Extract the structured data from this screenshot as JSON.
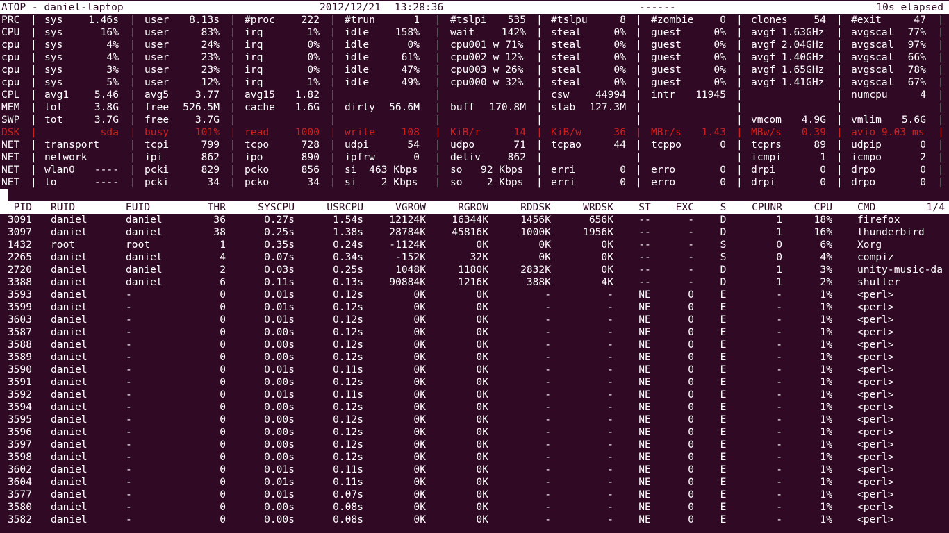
{
  "header": {
    "title": "ATOP - daniel-laptop",
    "date": "2012/12/21",
    "time": "13:28:36",
    "flags": "------",
    "elapsed": "10s elapsed"
  },
  "system_rows": [
    {
      "type": "PRC",
      "cells": [
        [
          "sys",
          "1.46s"
        ],
        [
          "user",
          "8.13s"
        ],
        [
          "#proc",
          "222"
        ],
        [
          "#trun",
          "1"
        ],
        [
          "#tslpi",
          "535"
        ],
        [
          "#tslpu",
          "8"
        ],
        [
          "#zombie",
          "0"
        ],
        [
          "clones",
          "54"
        ],
        [
          "#exit",
          "47"
        ]
      ]
    },
    {
      "type": "CPU",
      "cells": [
        [
          "sys",
          "16%"
        ],
        [
          "user",
          "83%"
        ],
        [
          "irq",
          "1%"
        ],
        [
          "idle",
          "158%"
        ],
        [
          "wait",
          "142%"
        ],
        [
          "steal",
          "0%"
        ],
        [
          "guest",
          "0%"
        ],
        [
          "avgf 1.63GHz",
          ""
        ],
        [
          "avgscal",
          "77%"
        ]
      ]
    },
    {
      "type": "cpu",
      "cells": [
        [
          "sys",
          "4%"
        ],
        [
          "user",
          "24%"
        ],
        [
          "irq",
          "0%"
        ],
        [
          "idle",
          "0%"
        ],
        [
          "cpu001 w 71%",
          ""
        ],
        [
          "steal",
          "0%"
        ],
        [
          "guest",
          "0%"
        ],
        [
          "avgf 2.04GHz",
          ""
        ],
        [
          "avgscal",
          "97%"
        ]
      ]
    },
    {
      "type": "cpu",
      "cells": [
        [
          "sys",
          "4%"
        ],
        [
          "user",
          "23%"
        ],
        [
          "irq",
          "0%"
        ],
        [
          "idle",
          "61%"
        ],
        [
          "cpu002 w 12%",
          ""
        ],
        [
          "steal",
          "0%"
        ],
        [
          "guest",
          "0%"
        ],
        [
          "avgf 1.40GHz",
          ""
        ],
        [
          "avgscal",
          "66%"
        ]
      ]
    },
    {
      "type": "cpu",
      "cells": [
        [
          "sys",
          "3%"
        ],
        [
          "user",
          "23%"
        ],
        [
          "irq",
          "0%"
        ],
        [
          "idle",
          "47%"
        ],
        [
          "cpu003 w 26%",
          ""
        ],
        [
          "steal",
          "0%"
        ],
        [
          "guest",
          "0%"
        ],
        [
          "avgf 1.65GHz",
          ""
        ],
        [
          "avgscal",
          "78%"
        ]
      ]
    },
    {
      "type": "cpu",
      "cells": [
        [
          "sys",
          "5%"
        ],
        [
          "user",
          "12%"
        ],
        [
          "irq",
          "1%"
        ],
        [
          "idle",
          "49%"
        ],
        [
          "cpu000 w 32%",
          ""
        ],
        [
          "steal",
          "0%"
        ],
        [
          "guest",
          "0%"
        ],
        [
          "avgf 1.41GHz",
          ""
        ],
        [
          "avgscal",
          "67%"
        ]
      ]
    },
    {
      "type": "CPL",
      "cells": [
        [
          "avg1",
          "5.46"
        ],
        [
          "avg5",
          "3.77"
        ],
        [
          "avg15",
          "1.82"
        ],
        [
          "",
          ""
        ],
        [
          "",
          ""
        ],
        [
          "csw",
          "44994"
        ],
        [
          "intr",
          "11945"
        ],
        [
          "",
          ""
        ],
        [
          "numcpu",
          "4"
        ]
      ]
    },
    {
      "type": "MEM",
      "cells": [
        [
          "tot",
          "3.8G"
        ],
        [
          "free",
          "526.5M"
        ],
        [
          "cache",
          "1.6G"
        ],
        [
          "dirty",
          "56.6M"
        ],
        [
          "buff",
          "170.8M"
        ],
        [
          "slab",
          "127.3M"
        ],
        [
          "",
          ""
        ],
        [
          "",
          ""
        ],
        [
          "",
          ""
        ]
      ]
    },
    {
      "type": "SWP",
      "cells": [
        [
          "tot",
          "3.7G"
        ],
        [
          "free",
          "3.7G"
        ],
        [
          "",
          ""
        ],
        [
          "",
          ""
        ],
        [
          "",
          ""
        ],
        [
          "",
          ""
        ],
        [
          "",
          ""
        ],
        [
          "vmcom",
          "4.9G"
        ],
        [
          "vmlim",
          "5.6G"
        ]
      ]
    },
    {
      "type": "DSK",
      "alert": true,
      "cells": [
        [
          "",
          "sda"
        ],
        [
          "busy",
          "101%"
        ],
        [
          "read",
          "1000"
        ],
        [
          "write",
          "108"
        ],
        [
          "KiB/r",
          "14"
        ],
        [
          "KiB/w",
          "36"
        ],
        [
          "MBr/s",
          "1.43"
        ],
        [
          "MBw/s",
          "0.39"
        ],
        [
          "avio 9.03 ms",
          ""
        ]
      ]
    },
    {
      "type": "NET",
      "cells": [
        [
          "transport",
          ""
        ],
        [
          "tcpi",
          "799"
        ],
        [
          "tcpo",
          "728"
        ],
        [
          "udpi",
          "54"
        ],
        [
          "udpo",
          "71"
        ],
        [
          "tcpao",
          "44"
        ],
        [
          "tcppo",
          "0"
        ],
        [
          "tcprs",
          "89"
        ],
        [
          "udpip",
          "0"
        ]
      ]
    },
    {
      "type": "NET",
      "cells": [
        [
          "network",
          ""
        ],
        [
          "ipi",
          "862"
        ],
        [
          "ipo",
          "890"
        ],
        [
          "ipfrw",
          "0"
        ],
        [
          "deliv",
          "862"
        ],
        [
          "",
          ""
        ],
        [
          "",
          ""
        ],
        [
          "icmpi",
          "1"
        ],
        [
          "icmpo",
          "2"
        ]
      ]
    },
    {
      "type": "NET",
      "cells": [
        [
          "wlan0",
          "----"
        ],
        [
          "pcki",
          "829"
        ],
        [
          "pcko",
          "856"
        ],
        [
          "si  463 Kbps",
          ""
        ],
        [
          "so   92 Kbps",
          ""
        ],
        [
          "erri",
          "0"
        ],
        [
          "erro",
          "0"
        ],
        [
          "drpi",
          "0"
        ],
        [
          "drpo",
          "0"
        ]
      ]
    },
    {
      "type": "NET",
      "cells": [
        [
          "lo",
          "----"
        ],
        [
          "pcki",
          "34"
        ],
        [
          "pcko",
          "34"
        ],
        [
          "si    2 Kbps",
          ""
        ],
        [
          "so    2 Kbps",
          ""
        ],
        [
          "erri",
          "0"
        ],
        [
          "erro",
          "0"
        ],
        [
          "drpi",
          "0"
        ],
        [
          "drpo",
          "0"
        ]
      ]
    }
  ],
  "process_table": {
    "columns": [
      "PID",
      "RUID",
      "EUID",
      "THR",
      "SYSCPU",
      "USRCPU",
      "VGROW",
      "RGROW",
      "RDDSK",
      "WRDSK",
      "ST",
      "EXC",
      "S",
      "CPUNR",
      "CPU",
      "CMD"
    ],
    "page": "1/4",
    "rows": [
      [
        "3091",
        "daniel",
        "daniel",
        "36",
        "0.27s",
        "1.54s",
        "12124K",
        "16344K",
        "1456K",
        "656K",
        "--",
        "-",
        "D",
        "1",
        "18%",
        "firefox"
      ],
      [
        "3097",
        "daniel",
        "daniel",
        "38",
        "0.25s",
        "1.38s",
        "28784K",
        "45816K",
        "1000K",
        "1956K",
        "--",
        "-",
        "D",
        "1",
        "16%",
        "thunderbird"
      ],
      [
        "1432",
        "root",
        "root",
        "1",
        "0.35s",
        "0.24s",
        "-1124K",
        "0K",
        "0K",
        "0K",
        "--",
        "-",
        "S",
        "0",
        "6%",
        "Xorg"
      ],
      [
        "2265",
        "daniel",
        "daniel",
        "4",
        "0.07s",
        "0.34s",
        "-152K",
        "32K",
        "0K",
        "0K",
        "--",
        "-",
        "S",
        "0",
        "4%",
        "compiz"
      ],
      [
        "2720",
        "daniel",
        "daniel",
        "2",
        "0.03s",
        "0.25s",
        "1048K",
        "1180K",
        "2832K",
        "0K",
        "--",
        "-",
        "D",
        "1",
        "3%",
        "unity-music-da"
      ],
      [
        "3388",
        "daniel",
        "daniel",
        "6",
        "0.11s",
        "0.13s",
        "90884K",
        "1216K",
        "388K",
        "4K",
        "--",
        "-",
        "D",
        "1",
        "2%",
        "shutter"
      ],
      [
        "3593",
        "daniel",
        "-",
        "0",
        "0.01s",
        "0.12s",
        "0K",
        "0K",
        "-",
        "-",
        "NE",
        "0",
        "E",
        "-",
        "1%",
        "<perl>"
      ],
      [
        "3599",
        "daniel",
        "-",
        "0",
        "0.01s",
        "0.12s",
        "0K",
        "0K",
        "-",
        "-",
        "NE",
        "0",
        "E",
        "-",
        "1%",
        "<perl>"
      ],
      [
        "3603",
        "daniel",
        "-",
        "0",
        "0.01s",
        "0.12s",
        "0K",
        "0K",
        "-",
        "-",
        "NE",
        "0",
        "E",
        "-",
        "1%",
        "<perl>"
      ],
      [
        "3587",
        "daniel",
        "-",
        "0",
        "0.00s",
        "0.12s",
        "0K",
        "0K",
        "-",
        "-",
        "NE",
        "0",
        "E",
        "-",
        "1%",
        "<perl>"
      ],
      [
        "3588",
        "daniel",
        "-",
        "0",
        "0.00s",
        "0.12s",
        "0K",
        "0K",
        "-",
        "-",
        "NE",
        "0",
        "E",
        "-",
        "1%",
        "<perl>"
      ],
      [
        "3589",
        "daniel",
        "-",
        "0",
        "0.00s",
        "0.12s",
        "0K",
        "0K",
        "-",
        "-",
        "NE",
        "0",
        "E",
        "-",
        "1%",
        "<perl>"
      ],
      [
        "3590",
        "daniel",
        "-",
        "0",
        "0.01s",
        "0.11s",
        "0K",
        "0K",
        "-",
        "-",
        "NE",
        "0",
        "E",
        "-",
        "1%",
        "<perl>"
      ],
      [
        "3591",
        "daniel",
        "-",
        "0",
        "0.00s",
        "0.12s",
        "0K",
        "0K",
        "-",
        "-",
        "NE",
        "0",
        "E",
        "-",
        "1%",
        "<perl>"
      ],
      [
        "3592",
        "daniel",
        "-",
        "0",
        "0.01s",
        "0.11s",
        "0K",
        "0K",
        "-",
        "-",
        "NE",
        "0",
        "E",
        "-",
        "1%",
        "<perl>"
      ],
      [
        "3594",
        "daniel",
        "-",
        "0",
        "0.00s",
        "0.12s",
        "0K",
        "0K",
        "-",
        "-",
        "NE",
        "0",
        "E",
        "-",
        "1%",
        "<perl>"
      ],
      [
        "3595",
        "daniel",
        "-",
        "0",
        "0.00s",
        "0.12s",
        "0K",
        "0K",
        "-",
        "-",
        "NE",
        "0",
        "E",
        "-",
        "1%",
        "<perl>"
      ],
      [
        "3596",
        "daniel",
        "-",
        "0",
        "0.00s",
        "0.12s",
        "0K",
        "0K",
        "-",
        "-",
        "NE",
        "0",
        "E",
        "-",
        "1%",
        "<perl>"
      ],
      [
        "3597",
        "daniel",
        "-",
        "0",
        "0.00s",
        "0.12s",
        "0K",
        "0K",
        "-",
        "-",
        "NE",
        "0",
        "E",
        "-",
        "1%",
        "<perl>"
      ],
      [
        "3598",
        "daniel",
        "-",
        "0",
        "0.00s",
        "0.12s",
        "0K",
        "0K",
        "-",
        "-",
        "NE",
        "0",
        "E",
        "-",
        "1%",
        "<perl>"
      ],
      [
        "3602",
        "daniel",
        "-",
        "0",
        "0.01s",
        "0.11s",
        "0K",
        "0K",
        "-",
        "-",
        "NE",
        "0",
        "E",
        "-",
        "1%",
        "<perl>"
      ],
      [
        "3604",
        "daniel",
        "-",
        "0",
        "0.01s",
        "0.11s",
        "0K",
        "0K",
        "-",
        "-",
        "NE",
        "0",
        "E",
        "-",
        "1%",
        "<perl>"
      ],
      [
        "3577",
        "daniel",
        "-",
        "0",
        "0.01s",
        "0.07s",
        "0K",
        "0K",
        "-",
        "-",
        "NE",
        "0",
        "E",
        "-",
        "1%",
        "<perl>"
      ],
      [
        "3580",
        "daniel",
        "-",
        "0",
        "0.00s",
        "0.08s",
        "0K",
        "0K",
        "-",
        "-",
        "NE",
        "0",
        "E",
        "-",
        "1%",
        "<perl>"
      ],
      [
        "3582",
        "daniel",
        "-",
        "0",
        "0.00s",
        "0.08s",
        "0K",
        "0K",
        "-",
        "-",
        "NE",
        "0",
        "E",
        "-",
        "1%",
        "<perl>"
      ]
    ]
  },
  "colors": {
    "background": "#300a24",
    "text": "#ffffff",
    "alert": "#cc1f1f"
  }
}
